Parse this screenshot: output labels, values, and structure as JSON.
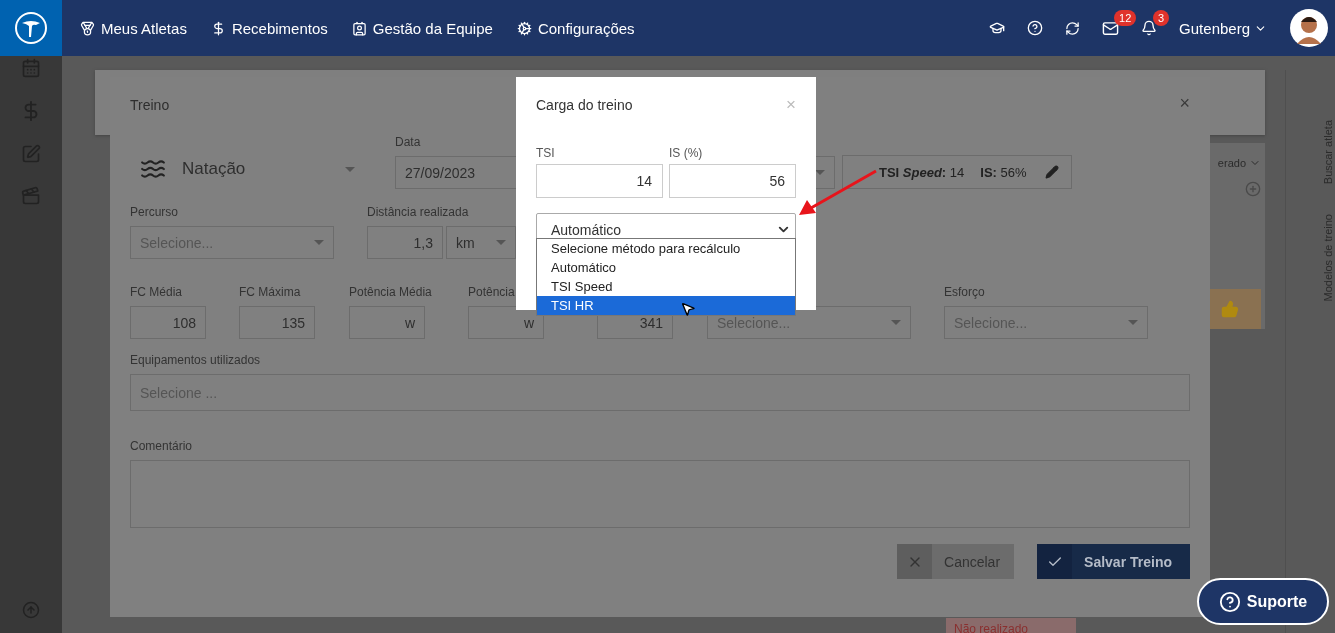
{
  "nav": {
    "items": [
      {
        "label": "Meus Atletas"
      },
      {
        "label": "Recebimentos"
      },
      {
        "label": "Gestão da Equipe"
      },
      {
        "label": "Configurações"
      }
    ],
    "mail_count": "12",
    "notification_count": "3",
    "user_name": "Gutenberg"
  },
  "side_tabs": [
    "Buscar atleta",
    "Modelos de treino"
  ],
  "background": {
    "select_value": "erado",
    "status": "Não realizado"
  },
  "treino": {
    "title": "Treino",
    "sport": "Natação",
    "date_label": "Data",
    "date": "27/09/2023",
    "summary": [
      {
        "label": "TSI *Speed*:",
        "value": "14"
      },
      {
        "label": "IS:",
        "value": "56%"
      }
    ],
    "route": {
      "label": "Percurso",
      "placeholder": "Selecione..."
    },
    "distance": {
      "label": "Distância realizada",
      "value": "1,3",
      "unit": "km"
    },
    "metrics": [
      {
        "kind": "input",
        "label": "FC Média",
        "value": "108"
      },
      {
        "kind": "input",
        "label": "FC Máxima",
        "value": "135"
      },
      {
        "kind": "unit",
        "label": "Potência Média",
        "unit": "w"
      },
      {
        "kind": "unit",
        "label": "Potência",
        "unit": "w"
      },
      {
        "kind": "input",
        "value": "341"
      },
      {
        "kind": "select",
        "placeholder": "Selecione..."
      },
      {
        "kind": "select",
        "label": "Esforço",
        "placeholder": "Selecione..."
      }
    ],
    "equipment": {
      "label": "Equipamentos utilizados",
      "placeholder": "Selecione ..."
    },
    "comment": {
      "label": "Comentário"
    },
    "buttons": [
      {
        "kind": "cancel",
        "label": "Cancelar"
      },
      {
        "kind": "save",
        "label": "Salvar Treino"
      }
    ]
  },
  "carga": {
    "title": "Carga do treino",
    "close": "×",
    "tsi_label": "TSI",
    "tsi": "14",
    "is_label": "IS (%)",
    "is": "56",
    "method": "Automático",
    "options": [
      {
        "label": "Selecione método para recálculo",
        "selected": false
      },
      {
        "label": "Automático",
        "selected": false
      },
      {
        "label": "TSI Speed",
        "selected": false
      },
      {
        "label": "TSI HR",
        "selected": true
      }
    ]
  },
  "treino_close": "×",
  "support": {
    "label": "Suporte"
  }
}
